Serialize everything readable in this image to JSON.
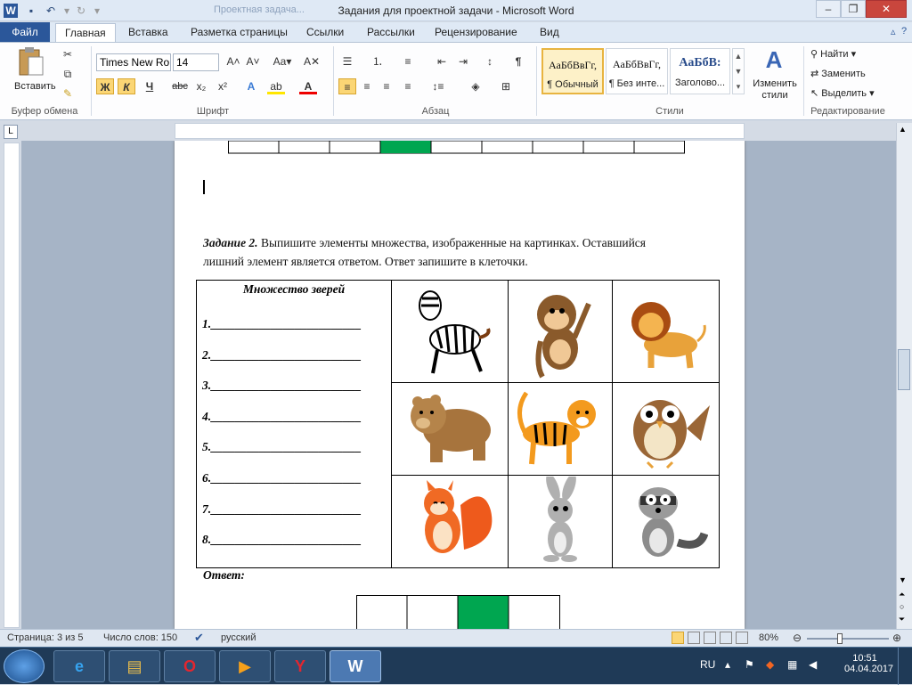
{
  "window": {
    "title": "Задания для проектной задачи  -  Microsoft Word",
    "tab_hint": "Проектная задача..."
  },
  "tabs": [
    {
      "label": "Файл"
    },
    {
      "label": "Главная"
    },
    {
      "label": "Вставка"
    },
    {
      "label": "Разметка страницы"
    },
    {
      "label": "Ссылки"
    },
    {
      "label": "Рассылки"
    },
    {
      "label": "Рецензирование"
    },
    {
      "label": "Вид"
    }
  ],
  "ribbon": {
    "paste_label": "Вставить",
    "font_name": "Times New Ro",
    "font_size": "14",
    "bold": "Ж",
    "italic": "К",
    "underline": "Ч",
    "strike": "abc",
    "sub": "x₂",
    "sup": "x²",
    "styles": [
      {
        "sample": "АаБбВвГг,",
        "name": "¶ Обычный"
      },
      {
        "sample": "АаБбВвГг,",
        "name": "¶ Без инте..."
      },
      {
        "sample": "АаБбВ:",
        "name": "Заголово..."
      }
    ],
    "change_styles": "Изменить стили",
    "find": "Найти",
    "replace": "Заменить",
    "select": "Выделить",
    "groups": {
      "clipboard": "Буфер обмена",
      "font": "Шрифт",
      "paragraph": "Абзац",
      "styles": "Стили",
      "editing": "Редактирование"
    }
  },
  "document": {
    "task_heading": "Задание 2.",
    "task_text_line1": "Выпишите элементы множества, изображенные на картинках. Оставшийся",
    "task_text_line2": "лишний элемент является ответом. Ответ запишите в клеточки.",
    "set_title": "Множество зверей",
    "set_items": [
      "1.",
      "2.",
      "3.",
      "4.",
      "5.",
      "6.",
      "7.",
      "8."
    ],
    "animals": [
      "zebra",
      "monkey",
      "lion",
      "bear",
      "tiger",
      "owl",
      "squirrel",
      "rabbit",
      "raccoon"
    ],
    "answer_label": "Ответ:"
  },
  "statusbar": {
    "page": "Страница: 3 из 5",
    "words": "Число слов: 150",
    "lang": "русский",
    "zoom": "80%"
  },
  "taskbar": {
    "lang": "RU",
    "time": "10:51",
    "date": "04.04.2017"
  },
  "colors": {
    "accent": "#2b579a",
    "answer_fill": "#00a650"
  }
}
